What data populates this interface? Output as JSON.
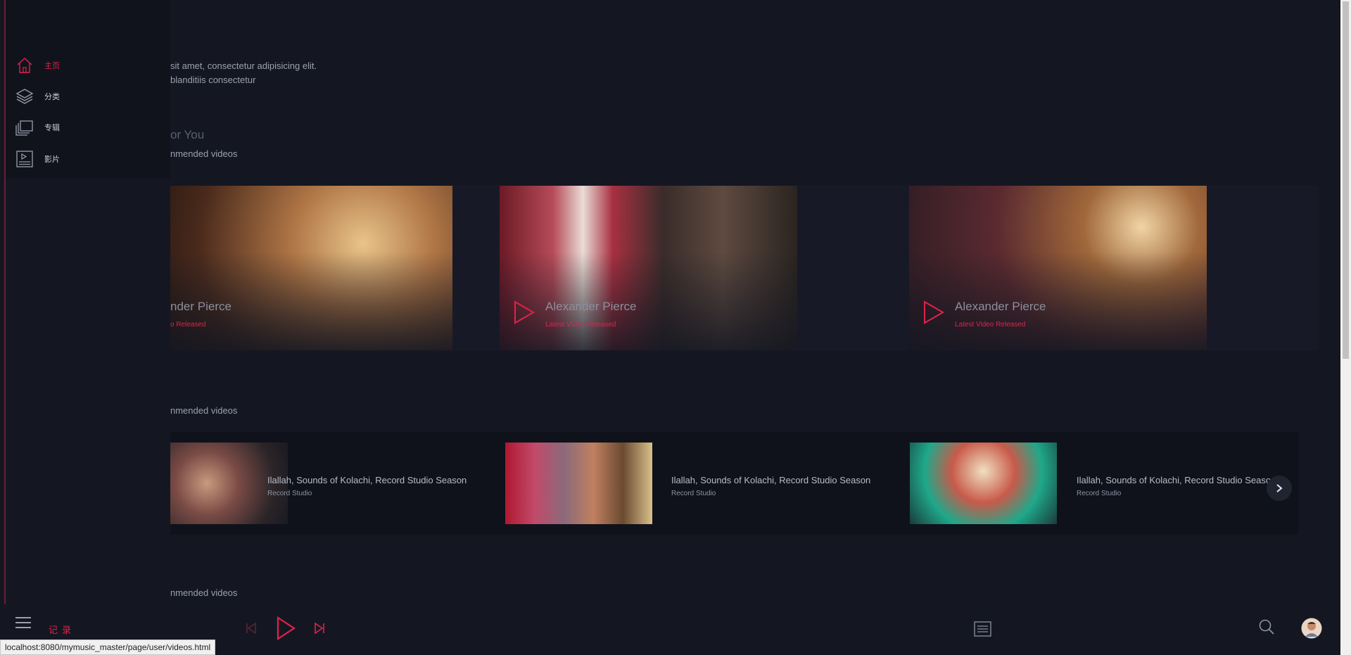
{
  "intro": {
    "line1": "sit amet, consectetur adipisicing elit.",
    "line2": "blanditiis consectetur"
  },
  "sections": [
    {
      "title": "or You",
      "subtitle": "nmended videos"
    },
    {
      "subtitle": "nmended videos"
    },
    {
      "subtitle": "nmended videos"
    }
  ],
  "featured_cards": [
    {
      "name": "nder Pierce",
      "sub": "o Released"
    },
    {
      "name": "Alexander Pierce",
      "sub": "Latest Video Released"
    },
    {
      "name": "Alexander Pierce",
      "sub": "Latest Video Released"
    }
  ],
  "strip_items": [
    {
      "title": "Ilallah, Sounds of Kolachi, Record Studio Season",
      "sub": "Record Studio"
    },
    {
      "title": "Ilallah, Sounds of Kolachi, Record Studio Season",
      "sub": "Record Studio"
    },
    {
      "title": "Ilallah, Sounds of Kolachi, Record Studio Season",
      "sub": "Record Studio"
    }
  ],
  "sidebar": {
    "items": [
      {
        "label": "主页",
        "icon": "home-icon",
        "active": true
      },
      {
        "label": "分类",
        "icon": "layers-icon",
        "active": false
      },
      {
        "label": "专辑",
        "icon": "album-icon",
        "active": false
      },
      {
        "label": "影片",
        "icon": "video-icon",
        "active": false
      }
    ]
  },
  "player": {
    "record_label": "记录"
  },
  "status_url": "localhost:8080/mymusic_master/page/user/videos.html",
  "colors": {
    "accent": "#e0224a",
    "background": "#141722",
    "panel": "#11131c"
  }
}
